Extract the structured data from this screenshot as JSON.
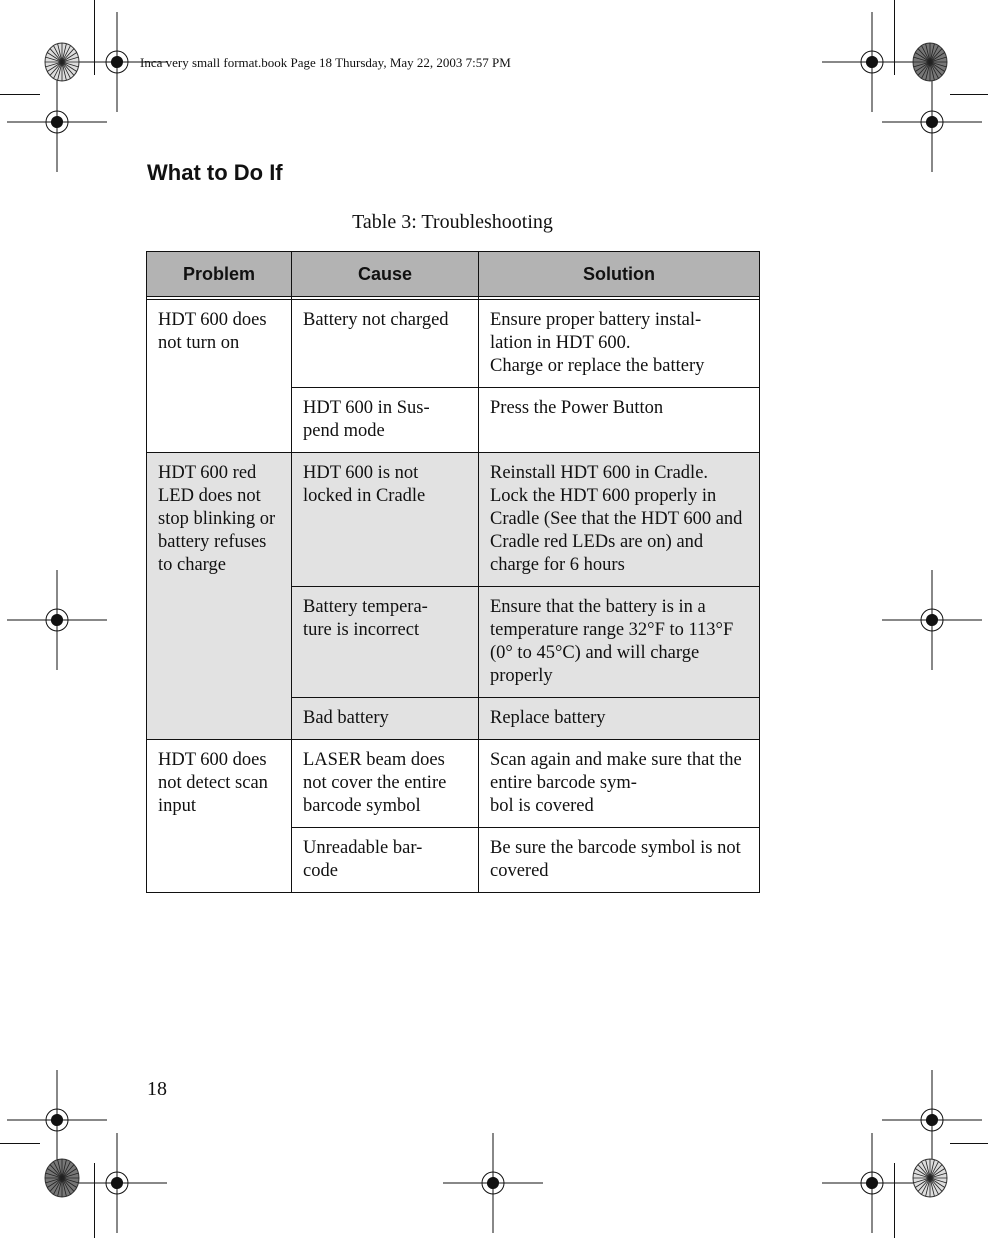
{
  "header": {
    "running_head": "Inca very small format.book  Page 18  Thursday, May 22, 2003  7:57 PM"
  },
  "section_title": "What to Do If",
  "table": {
    "caption": "Table 3: Troubleshooting",
    "columns": [
      "Problem",
      "Cause",
      "Solution"
    ],
    "groups": [
      {
        "problem": "HDT 600 does not turn on",
        "shaded": false,
        "rows": [
          {
            "cause": "Battery not charged",
            "solution": "Ensure proper battery instal-\nlation in HDT 600.\nCharge or replace the battery"
          },
          {
            "cause": "HDT 600 in Sus-\npend mode",
            "solution": "Press the Power Button"
          }
        ]
      },
      {
        "problem": "HDT 600 red LED does not stop blinking or battery refuses to charge",
        "shaded": true,
        "rows": [
          {
            "cause": "HDT 600 is not locked in Cradle",
            "solution": "Reinstall HDT 600 in Cradle. Lock the HDT 600 properly in Cradle (See that the HDT 600 and Cradle red LEDs are on) and charge for 6 hours"
          },
          {
            "cause": "Battery tempera-\nture is incorrect",
            "solution": "Ensure that the battery is in a temperature range 32°F to 113°F (0° to 45°C) and will charge properly"
          },
          {
            "cause": "Bad battery",
            "solution": "Replace battery"
          }
        ]
      },
      {
        "problem": "HDT 600 does not detect scan input",
        "shaded": false,
        "rows": [
          {
            "cause": "LASER beam does not cover the entire barcode symbol",
            "solution": "Scan again and make sure that the entire barcode sym-\nbol is covered"
          },
          {
            "cause": "Unreadable bar-\ncode",
            "solution": "Be sure the barcode symbol is not covered"
          }
        ]
      }
    ]
  },
  "page_number": "18",
  "icons": {
    "registration": "crosshair-registration-mark",
    "color_bar": "radial-star-target"
  }
}
